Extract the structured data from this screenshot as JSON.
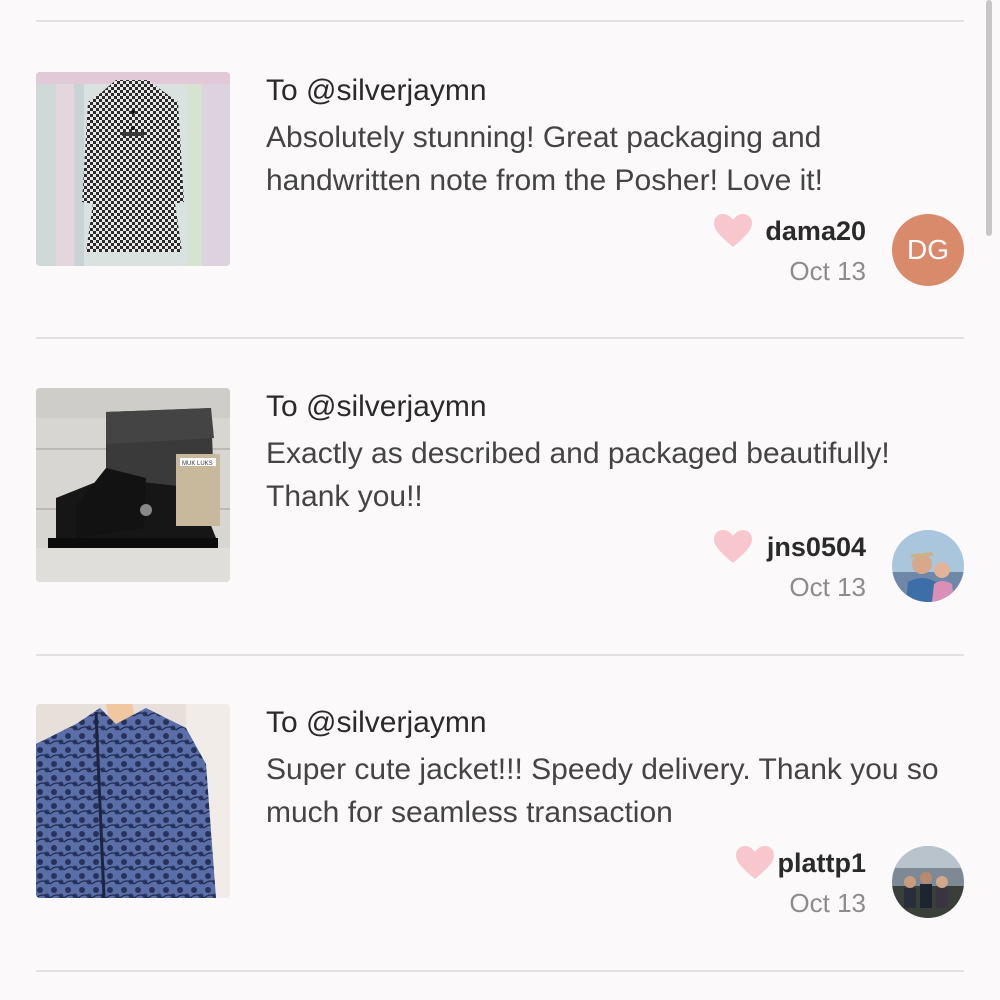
{
  "reviews": [
    {
      "to": "To @silverjaymn",
      "comment": "Absolutely stunning! Great packaging and handwritten note from the Posher! Love it!",
      "username": "dama20",
      "date": "Oct 13",
      "avatar_initials": "DG",
      "avatar_color": "#d98a6a",
      "item_image": "houndstooth-coat-photo"
    },
    {
      "to": "To @silverjaymn",
      "comment": "Exactly as described and packaged beautifully! Thank you!!",
      "username": "jns0504",
      "date": "Oct 13",
      "item_image": "black-suede-boots-photo",
      "tag_text": "MUK LUKS"
    },
    {
      "to": "To @silverjaymn",
      "comment": "Super cute jacket!!! Speedy delivery. Thank you so much for seamless transaction",
      "username": "plattp1",
      "date": "Oct 13",
      "item_image": "blue-paisley-jacket-photo"
    }
  ],
  "colors": {
    "background": "#fbf9fa",
    "heart": "#f7c7cd",
    "divider": "#e3e0e1"
  }
}
